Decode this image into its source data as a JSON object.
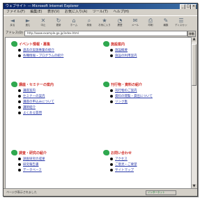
{
  "window": {
    "title": "ウェブサイト — Microsoft Internet Explorer"
  },
  "menubar": [
    "ファイル(F)",
    "編集(E)",
    "表示(V)",
    "お気に入り(A)",
    "ツール(T)",
    "ヘルプ(H)"
  ],
  "toolbar": [
    {
      "icon": "back-icon",
      "glyph": "◄",
      "label": "戻る"
    },
    {
      "icon": "forward-icon",
      "glyph": "►",
      "label": "進む"
    },
    {
      "icon": "stop-icon",
      "glyph": "✕",
      "label": "中止"
    },
    {
      "icon": "refresh-icon",
      "glyph": "↻",
      "label": "更新"
    },
    {
      "icon": "home-icon",
      "glyph": "⌂",
      "label": "ホーム"
    },
    {
      "icon": "search-icon",
      "glyph": "⌕",
      "label": "検索"
    },
    {
      "icon": "favorites-icon",
      "glyph": "★",
      "label": "お気に入り"
    },
    {
      "icon": "history-icon",
      "glyph": "◔",
      "label": "履歴"
    },
    {
      "icon": "mail-icon",
      "glyph": "✉",
      "label": "メール"
    },
    {
      "icon": "print-icon",
      "glyph": "⎙",
      "label": "印刷"
    },
    {
      "icon": "edit-icon",
      "glyph": "✎",
      "label": "編集"
    },
    {
      "icon": "discuss-icon",
      "glyph": "☰",
      "label": "ディスカッション"
    }
  ],
  "address": {
    "label": "アドレス(D)",
    "value": "http://www.example.go.jp/index.html",
    "go": "移動"
  },
  "sections": [
    {
      "title": "イベント情報・募集",
      "items": [
        "過去の実施事業の紹介",
        "各種情報・プログラムの紹介"
      ]
    },
    {
      "title": "施設案内",
      "items": [
        "施設概要",
        "施設の利用案内"
      ]
    },
    {
      "title": "講座・セミナーの案内",
      "items": [
        "講座案内",
        "セミナーの案内",
        "講座の申込みについて",
        "講師紹介",
        "よくある質問"
      ]
    },
    {
      "title": "刊行物・資料の紹介",
      "items": [
        "刊行物のご案内",
        "資料の閲覧・貸出について",
        "リンク集"
      ]
    },
    {
      "title": "調査・研究の紹介",
      "items": [
        "調査研究の成果",
        "研究報告書",
        "データベース"
      ]
    },
    {
      "title": "お問い合わせ",
      "items": [
        "アクセス",
        "ご意見・ご要望",
        "サイトマップ"
      ]
    }
  ],
  "status": {
    "text": "ページが表示されました",
    "zone": "インターネット"
  }
}
